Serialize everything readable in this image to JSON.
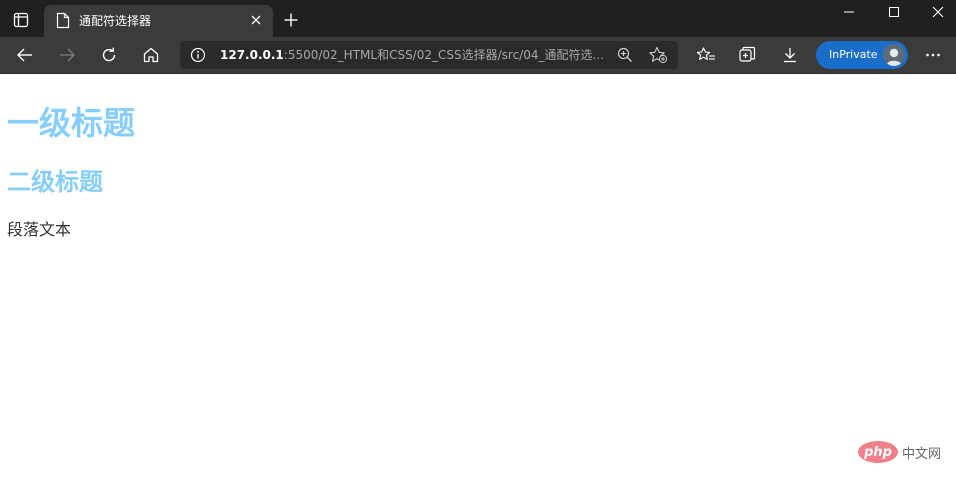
{
  "browser": {
    "tab": {
      "title": "通配符选择器"
    },
    "address": {
      "host": "127.0.0.1",
      "path": ":5500/02_HTML和CSS/02_CSS选择器/src/04_通配符选..."
    },
    "inprivate_label": "InPrivate",
    "colors": {
      "tabbar": "#202020",
      "toolbar": "#3b3b3b",
      "inprivate": "#1a6ec9"
    }
  },
  "page": {
    "h1": "一级标题",
    "h2": "二级标题",
    "paragraph": "段落文本",
    "heading_color": "#87cefa"
  },
  "watermark": {
    "logo": "php",
    "text": "中文网"
  }
}
